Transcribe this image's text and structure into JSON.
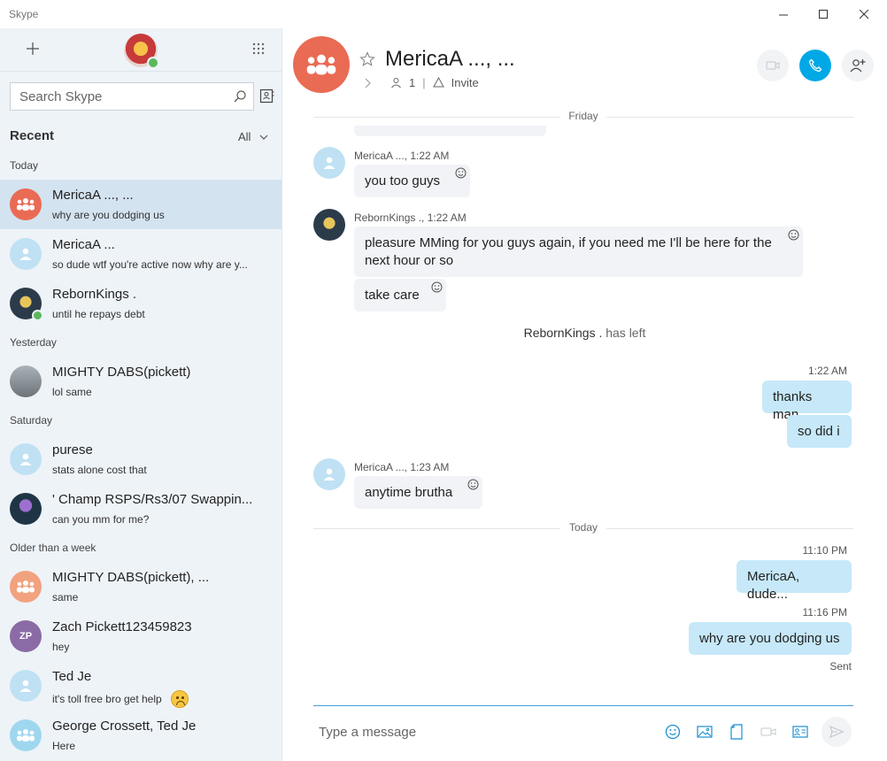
{
  "window": {
    "title": "Skype"
  },
  "sidebar": {
    "search_placeholder": "Search Skype",
    "recent_label": "Recent",
    "filter_label": "All",
    "groups": {
      "today": "Today",
      "yesterday": "Yesterday",
      "saturday": "Saturday",
      "older": "Older than a week"
    },
    "conversations": [
      {
        "name": "MericaA ..., ...",
        "preview": "why are you dodging us",
        "avatar": "group",
        "initials": ""
      },
      {
        "name": "MericaA ...",
        "preview": "so dude wtf you're active now why are y...",
        "avatar": "person",
        "initials": ""
      },
      {
        "name": "RebornKings .",
        "preview": "until he repays debt",
        "avatar": "picture",
        "initials": ""
      },
      {
        "name": "MIGHTY DABS(pickett)",
        "preview": "lol same",
        "avatar": "picture",
        "initials": ""
      },
      {
        "name": "purese",
        "preview": "stats alone cost that",
        "avatar": "person",
        "initials": ""
      },
      {
        "name": "' Champ RSPS/Rs3/07 Swappin...",
        "preview": "can you mm for me?",
        "avatar": "picture",
        "initials": ""
      },
      {
        "name": "MIGHTY DABS(pickett), ...",
        "preview": "same",
        "avatar": "group",
        "initials": ""
      },
      {
        "name": "Zach Pickett123459823",
        "preview": "hey",
        "avatar": "initials",
        "initials": "ZP"
      },
      {
        "name": "Ted Je",
        "preview": "it's toll free bro get help",
        "avatar": "person",
        "initials": ""
      },
      {
        "name": "George  Crossett, Ted Je",
        "preview": "Here",
        "avatar": "group",
        "initials": ""
      }
    ]
  },
  "chat": {
    "title": "MericaA ..., ...",
    "participants_count": "1",
    "invite_label": "Invite",
    "day_friday": "Friday",
    "day_today": "Today",
    "messages": [
      {
        "sender": "MericaA ...,",
        "time": "1:22 AM",
        "text": "you too guys"
      },
      {
        "sender": "RebornKings .,",
        "time": "1:22 AM",
        "text": "pleasure MMing for you guys again, if you need me I'll be here for the next hour or so"
      },
      {
        "sender": "",
        "time": "",
        "text": "take care"
      },
      {
        "sender": "",
        "time": "1:22 AM",
        "text": "thanks man"
      },
      {
        "sender": "",
        "time": "",
        "text": "so did i"
      },
      {
        "sender": "MericaA ...,",
        "time": "1:23 AM",
        "text": "anytime brutha"
      },
      {
        "sender": "",
        "time": "11:10 PM",
        "text": "MericaA, dude..."
      },
      {
        "sender": "",
        "time": "11:16 PM",
        "text": "why are you dodging us"
      }
    ],
    "system_name": "RebornKings .",
    "system_action": "has left",
    "sent_status": "Sent",
    "compose_placeholder": "Type a message"
  },
  "colors": {
    "accent": "#00a8e6",
    "group_avatar": "#ea6b54",
    "outgoing_bubble": "#c6e8f8",
    "incoming_bubble": "#f1f3f6"
  }
}
